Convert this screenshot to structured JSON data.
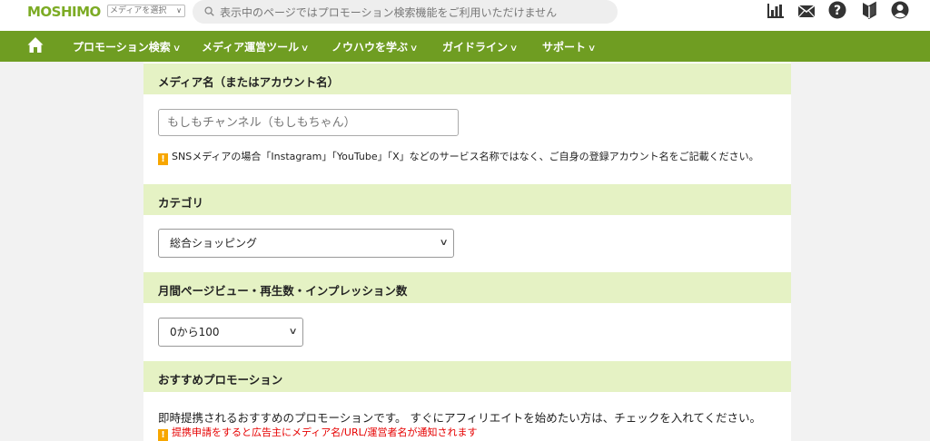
{
  "header": {
    "logo": "MOSHIMO",
    "media_select": "メディアを選択",
    "search_placeholder": "表示中のページではプロモーション検索機能をご利用いただけません",
    "icons": [
      "report-icon",
      "mail-icon",
      "help-icon",
      "beginner-icon",
      "user-icon"
    ]
  },
  "nav": {
    "items": [
      {
        "label": "プロモーション検索"
      },
      {
        "label": "メディア運営ツール"
      },
      {
        "label": "ノウハウを学ぶ"
      },
      {
        "label": "ガイドライン"
      },
      {
        "label": "サポート"
      }
    ]
  },
  "form": {
    "media_name": {
      "heading": "メディア名（またはアカウント名）",
      "placeholder": "もしもチャンネル（もしもちゃん）",
      "note": "SNSメディアの場合「Instagram」「YouTube」「X」などのサービス名称ではなく、ご自身の登録アカウント名をご記載ください。"
    },
    "category": {
      "heading": "カテゴリ",
      "selected": "総合ショッピング"
    },
    "pageviews": {
      "heading": "月間ページビュー・再生数・インプレッション数",
      "selected": "0から100"
    },
    "recommended": {
      "heading": "おすすめプロモーション",
      "description": "即時提携されるおすすめのプロモーションです。 すぐにアフィリエイトを始めたい方は、チェックを入れてください。",
      "warning": "提携申請をすると広告主にメディア名/URL/運営者名が通知されます"
    }
  },
  "colors": {
    "brand_green": "#6f9d22",
    "section_bg": "#e5f2c4",
    "warning_orange": "#f7a600",
    "warning_red": "#e60000"
  }
}
